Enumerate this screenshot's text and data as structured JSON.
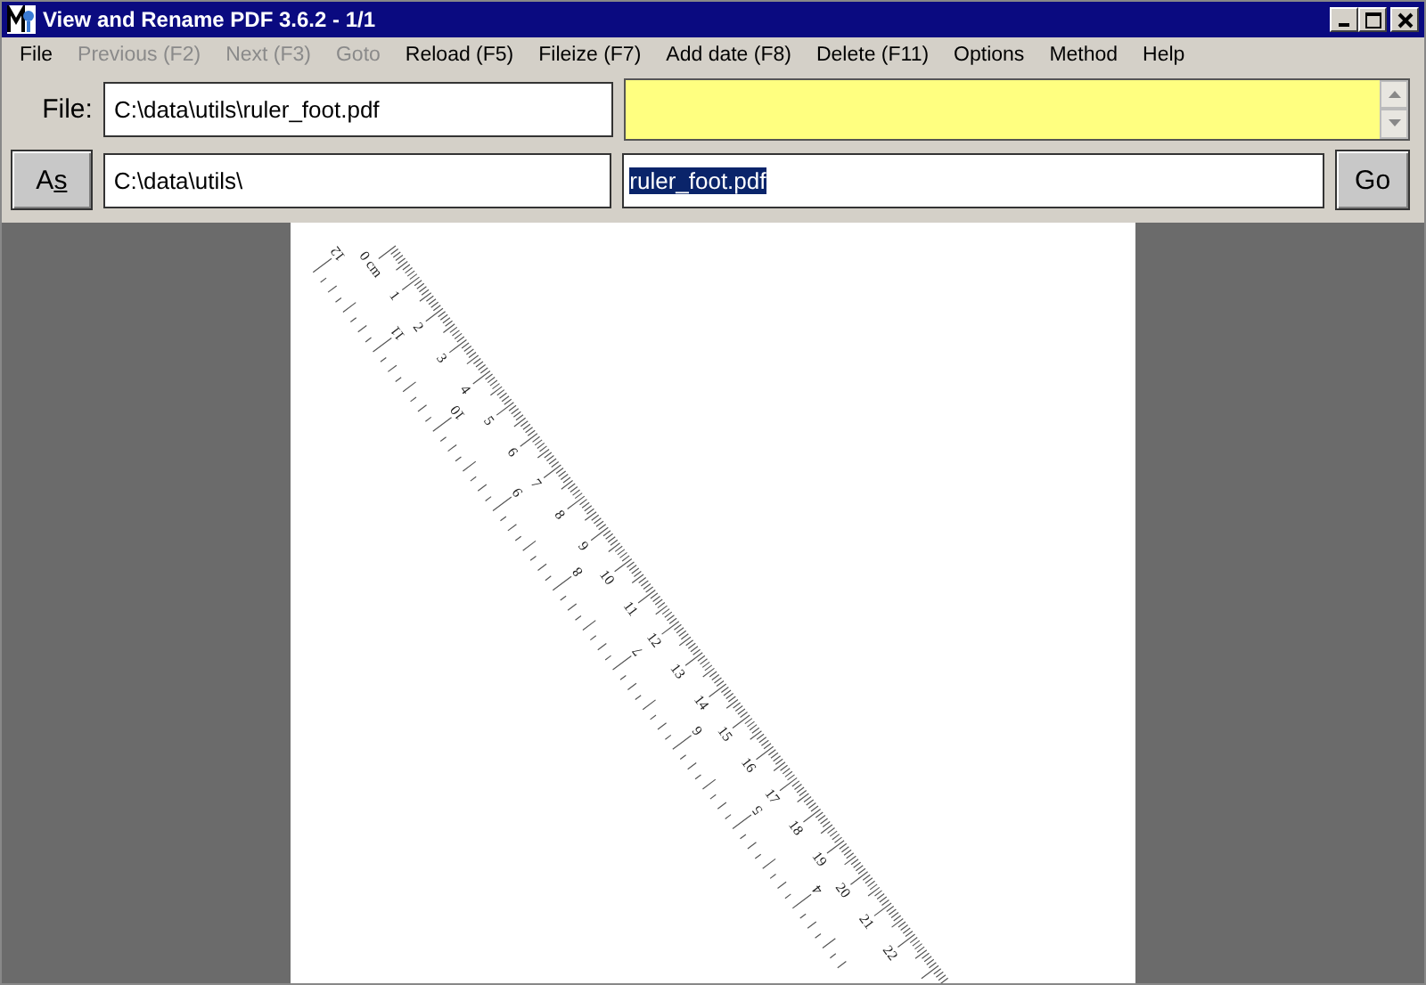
{
  "window": {
    "title": "View and Rename PDF 3.6.2 - 1/1"
  },
  "menu": [
    {
      "label": "File",
      "disabled": false
    },
    {
      "label": "Previous (F2)",
      "disabled": true
    },
    {
      "label": "Next (F3)",
      "disabled": true
    },
    {
      "label": "Goto",
      "disabled": true
    },
    {
      "label": "Reload (F5)",
      "disabled": false
    },
    {
      "label": "Fileize (F7)",
      "disabled": false
    },
    {
      "label": "Add date (F8)",
      "disabled": false
    },
    {
      "label": "Delete (F11)",
      "disabled": false
    },
    {
      "label": "Options",
      "disabled": false
    },
    {
      "label": "Method",
      "disabled": false
    },
    {
      "label": "Help",
      "disabled": false
    }
  ],
  "file_row": {
    "label": "File:",
    "path": "C:\\data\\utils\\ruler_foot.pdf"
  },
  "as_row": {
    "button": "As",
    "folder": "C:\\data\\utils\\",
    "new_name": "ruler_foot.pdf",
    "name_selected": true,
    "go": "Go"
  },
  "document": {
    "cm_labels": [
      "0 cm",
      "1",
      "2",
      "3",
      "4",
      "5",
      "6",
      "7",
      "8",
      "9",
      "10",
      "11",
      "12",
      "13",
      "14",
      "15",
      "16",
      "17",
      "18",
      "19",
      "20",
      "21",
      "22"
    ],
    "inch_labels": [
      "12",
      "11",
      "10",
      "9",
      "8",
      "7",
      "6",
      "5",
      "4"
    ]
  }
}
